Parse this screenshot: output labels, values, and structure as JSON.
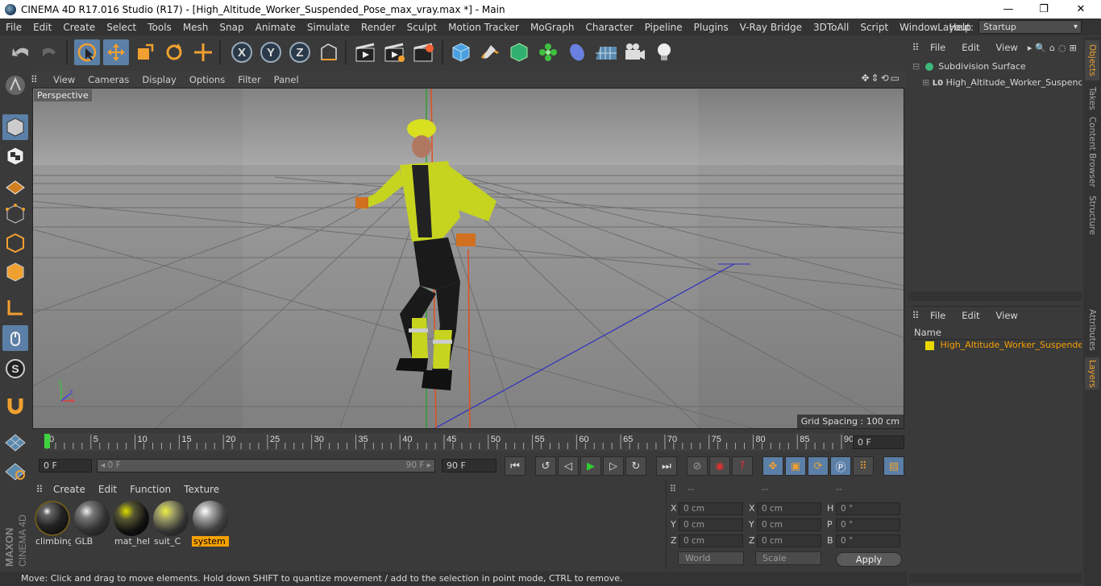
{
  "window": {
    "title": "CINEMA 4D R17.016 Studio (R17) - [High_Altitude_Worker_Suspended_Pose_max_vray.max *] - Main",
    "controls": {
      "minimize": "—",
      "maximize": "❐",
      "close": "✕"
    }
  },
  "menubar": {
    "items": [
      "File",
      "Edit",
      "Create",
      "Select",
      "Tools",
      "Mesh",
      "Snap",
      "Animate",
      "Simulate",
      "Render",
      "Sculpt",
      "Motion Tracker",
      "MoGraph",
      "Character",
      "Pipeline",
      "Plugins",
      "V-Ray Bridge",
      "3DToAll",
      "Script",
      "Window",
      "Help"
    ],
    "layout_label": "Layout:",
    "layout_value": "Startup"
  },
  "toolbar": {
    "axis_x": "X",
    "axis_y": "Y",
    "axis_z": "Z"
  },
  "viewport": {
    "menu": [
      "View",
      "Cameras",
      "Display",
      "Options",
      "Filter",
      "Panel"
    ],
    "label": "Perspective",
    "grid_spacing": "Grid Spacing : 100 cm",
    "axis_labels": {
      "x": "x",
      "y": "y",
      "z": "z"
    }
  },
  "timeline": {
    "ticks": [
      "0",
      "5",
      "10",
      "15",
      "20",
      "25",
      "30",
      "35",
      "40",
      "45",
      "50",
      "55",
      "60",
      "65",
      "70",
      "75",
      "80",
      "85",
      "90"
    ],
    "current_frame": "0 F",
    "current": 0,
    "max": 90
  },
  "playbar": {
    "start_field": "0 F",
    "range_start": "◂ 0 F",
    "range_end": "90 F ▸",
    "end_field": "90 F"
  },
  "materials": {
    "menu": [
      "Create",
      "Edit",
      "Function",
      "Texture"
    ],
    "items": [
      {
        "name": "climbing",
        "active": false
      },
      {
        "name": "GLB",
        "active": false
      },
      {
        "name": "mat_hel",
        "active": false
      },
      {
        "name": "suit_C",
        "active": false
      },
      {
        "name": "system",
        "active": true
      }
    ]
  },
  "coordinates": {
    "headers": [
      "--",
      "--",
      "--"
    ],
    "rows": [
      {
        "a_label": "X",
        "a_val": "0 cm",
        "b_label": "X",
        "b_val": "0 cm",
        "c_label": "H",
        "c_val": "0 °"
      },
      {
        "a_label": "Y",
        "a_val": "0 cm",
        "b_label": "Y",
        "b_val": "0 cm",
        "c_label": "P",
        "c_val": "0 °"
      },
      {
        "a_label": "Z",
        "a_val": "0 cm",
        "b_label": "Z",
        "b_val": "0 cm",
        "c_label": "B",
        "c_val": "0 °"
      }
    ],
    "space": "World",
    "mode": "Scale",
    "apply": "Apply"
  },
  "status": {
    "text": "Move: Click and drag to move elements. Hold down SHIFT to quantize movement / add to the selection in point mode, CTRL to remove."
  },
  "objects_panel": {
    "menu": [
      "File",
      "Edit",
      "View"
    ],
    "tree": [
      {
        "name": "Subdivision Surface"
      },
      {
        "name": "High_Altitude_Worker_Suspended"
      }
    ]
  },
  "layers_panel": {
    "menu": [
      "File",
      "Edit",
      "View"
    ],
    "column": "Name",
    "items": [
      {
        "name": "High_Altitude_Worker_Suspended"
      }
    ]
  },
  "side_tabs": [
    "Objects",
    "Takes",
    "Content Browser",
    "Structure",
    "Attributes",
    "Layers"
  ],
  "brand": {
    "line1": "MAXON",
    "line2": "CINEMA 4D"
  },
  "colors": {
    "accent": "#5b7fa6",
    "selection": "#f5a000",
    "layer": "#e8d800"
  }
}
